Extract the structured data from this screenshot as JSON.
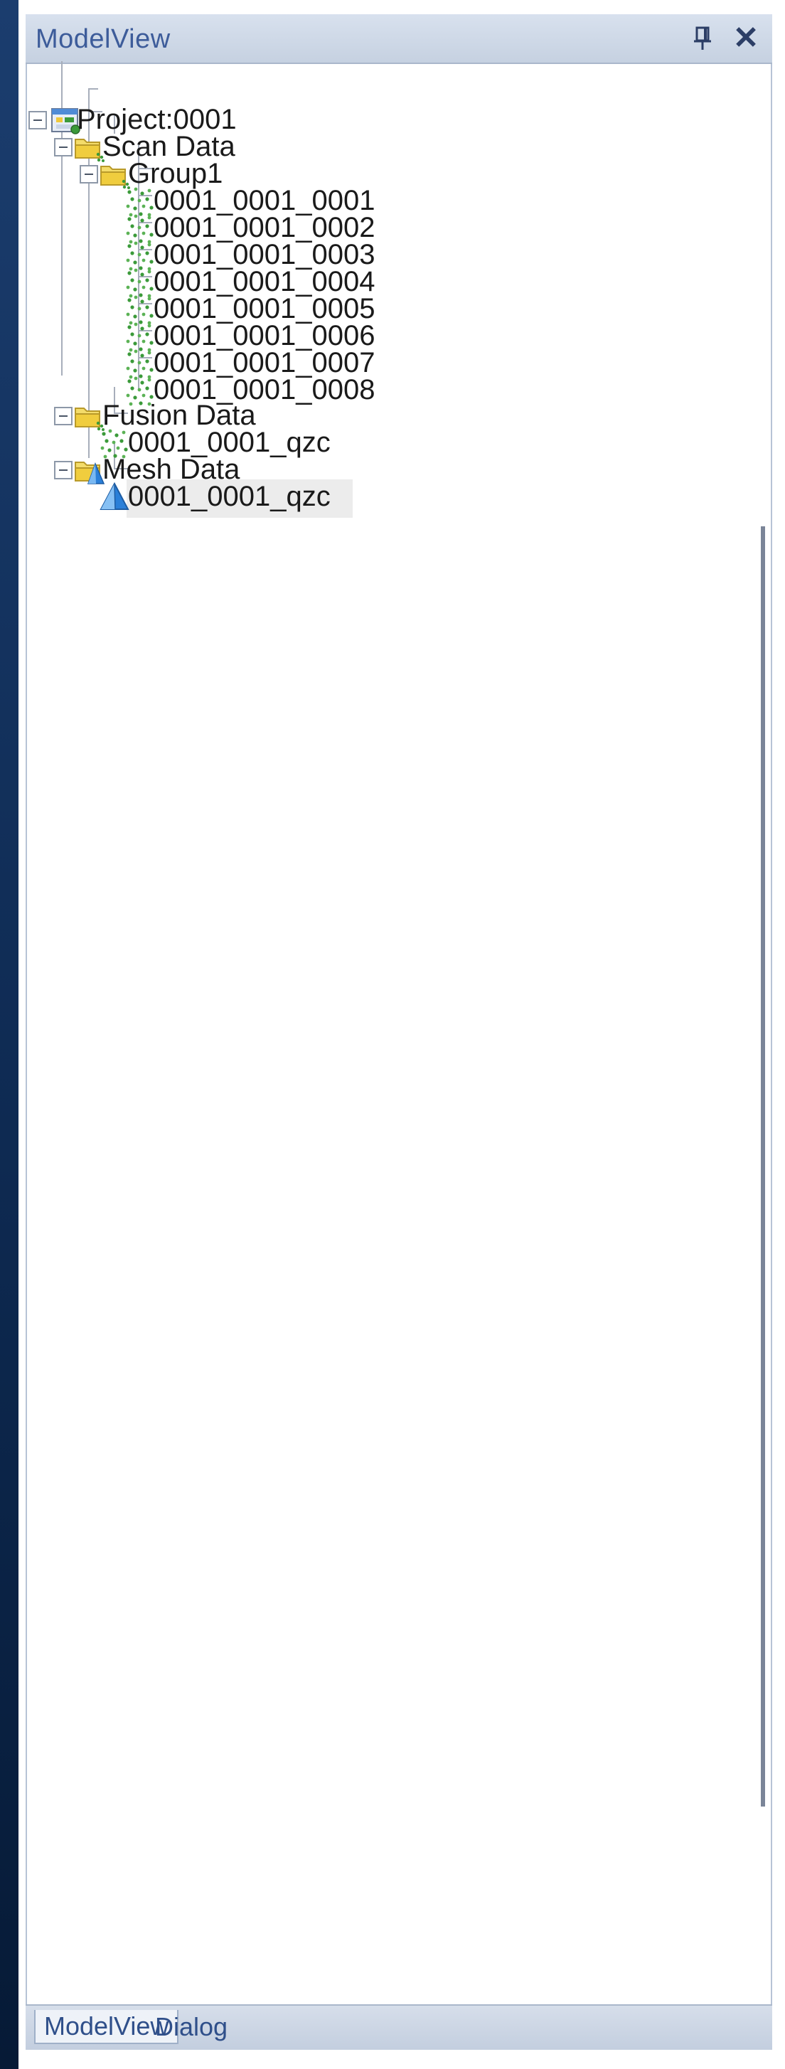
{
  "panel": {
    "title": "ModelView",
    "pin_icon": "pin-icon",
    "close_icon": "close-icon",
    "close_glyph": "✕"
  },
  "tree": {
    "project": {
      "label": "Project:0001",
      "icon": "project-icon"
    },
    "scan_data": {
      "label": "Scan Data",
      "icon": "folder-icon"
    },
    "group1": {
      "label": "Group1",
      "icon": "folder-icon"
    },
    "scans": [
      {
        "label": "0001_0001_0001",
        "icon": "point-cloud-icon"
      },
      {
        "label": "0001_0001_0002",
        "icon": "point-cloud-icon"
      },
      {
        "label": "0001_0001_0003",
        "icon": "point-cloud-icon"
      },
      {
        "label": "0001_0001_0004",
        "icon": "point-cloud-icon"
      },
      {
        "label": "0001_0001_0005",
        "icon": "point-cloud-icon"
      },
      {
        "label": "0001_0001_0006",
        "icon": "point-cloud-icon"
      },
      {
        "label": "0001_0001_0007",
        "icon": "point-cloud-icon"
      },
      {
        "label": "0001_0001_0008",
        "icon": "point-cloud-icon"
      }
    ],
    "fusion_data": {
      "label": "Fusion Data",
      "icon": "folder-icon"
    },
    "fusion_item": {
      "label": "0001_0001_qzc",
      "icon": "point-cloud-icon"
    },
    "mesh_data": {
      "label": "Mesh Data",
      "icon": "mesh-folder-icon"
    },
    "mesh_item": {
      "label": "0001_0001_qzc",
      "icon": "mesh-icon",
      "selected": true
    }
  },
  "tabs": [
    {
      "label": "ModelView",
      "active": true
    },
    {
      "label": "Dialog",
      "active": false
    }
  ],
  "colors": {
    "title_text": "#3d5c9a",
    "point_cloud": "#3b9a3a",
    "folder": "#f0d248",
    "mesh": "#2a7fd8"
  }
}
